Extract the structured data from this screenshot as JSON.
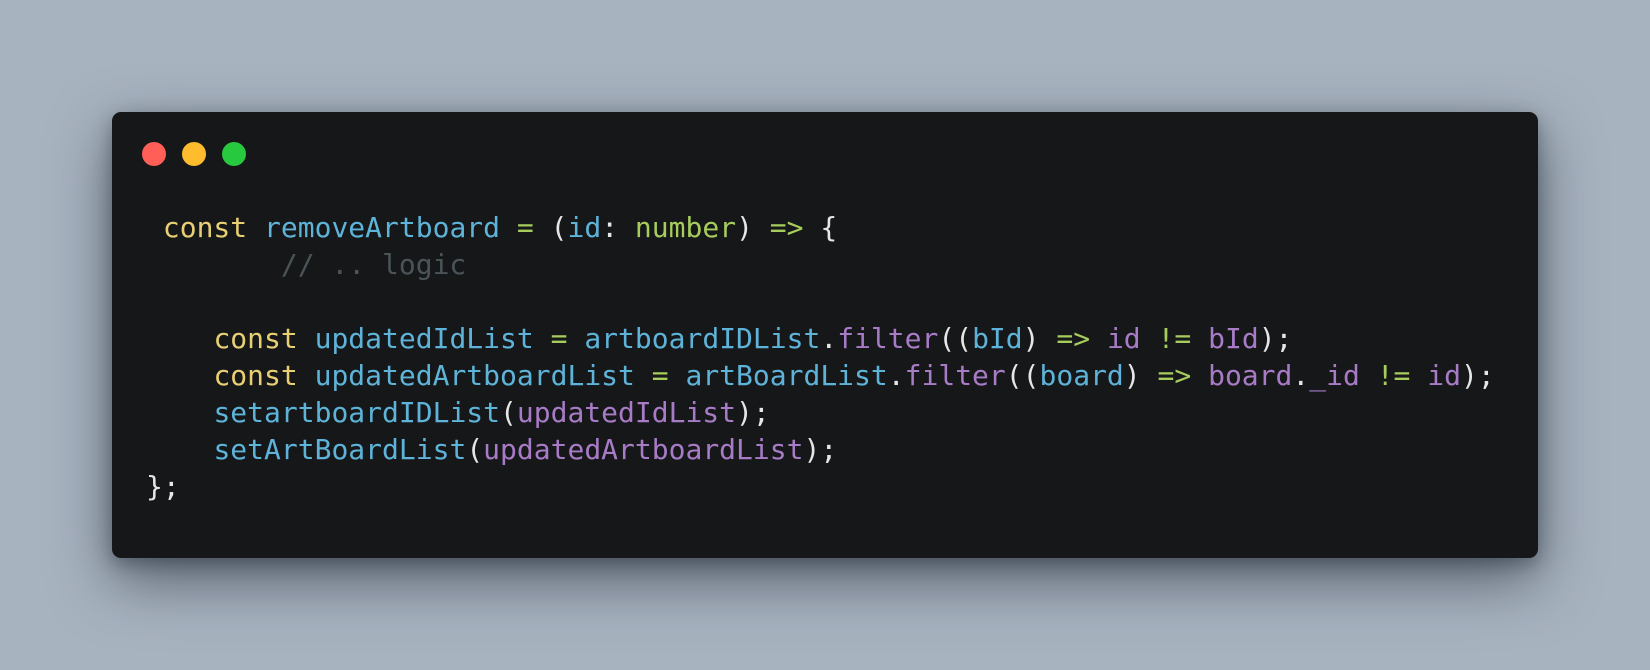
{
  "window": {
    "controls": [
      {
        "name": "close",
        "color": "#ff5f56"
      },
      {
        "name": "minimize",
        "color": "#ffbd2e"
      },
      {
        "name": "maximize",
        "color": "#27c93f"
      }
    ],
    "background": "#161719"
  },
  "code": {
    "lines": [
      [
        {
          "t": " ",
          "c": "ws"
        },
        {
          "t": "const",
          "c": "keyword"
        },
        {
          "t": " ",
          "c": "ws"
        },
        {
          "t": "removeArtboard",
          "c": "ident"
        },
        {
          "t": " ",
          "c": "ws"
        },
        {
          "t": "=",
          "c": "op"
        },
        {
          "t": " ",
          "c": "ws"
        },
        {
          "t": "(",
          "c": "punct"
        },
        {
          "t": "id",
          "c": "ident"
        },
        {
          "t": ": ",
          "c": "punct"
        },
        {
          "t": "number",
          "c": "type"
        },
        {
          "t": ")",
          "c": "punct"
        },
        {
          "t": " ",
          "c": "ws"
        },
        {
          "t": "=>",
          "c": "op"
        },
        {
          "t": " ",
          "c": "ws"
        },
        {
          "t": "{",
          "c": "punct"
        }
      ],
      [
        {
          "t": "        ",
          "c": "ws"
        },
        {
          "t": "// .. logic",
          "c": "comment"
        }
      ],
      [
        {
          "t": " ",
          "c": "ws"
        }
      ],
      [
        {
          "t": "    ",
          "c": "ws"
        },
        {
          "t": "const",
          "c": "keyword"
        },
        {
          "t": " ",
          "c": "ws"
        },
        {
          "t": "updatedIdList",
          "c": "ident"
        },
        {
          "t": " ",
          "c": "ws"
        },
        {
          "t": "=",
          "c": "op"
        },
        {
          "t": " ",
          "c": "ws"
        },
        {
          "t": "artboardIDList",
          "c": "ident"
        },
        {
          "t": ".",
          "c": "punct"
        },
        {
          "t": "filter",
          "c": "method"
        },
        {
          "t": "((",
          "c": "punct"
        },
        {
          "t": "bId",
          "c": "ident"
        },
        {
          "t": ")",
          "c": "punct"
        },
        {
          "t": " ",
          "c": "ws"
        },
        {
          "t": "=>",
          "c": "op"
        },
        {
          "t": " ",
          "c": "ws"
        },
        {
          "t": "id",
          "c": "var"
        },
        {
          "t": " ",
          "c": "ws"
        },
        {
          "t": "!=",
          "c": "op"
        },
        {
          "t": " ",
          "c": "ws"
        },
        {
          "t": "bId",
          "c": "var"
        },
        {
          "t": ");",
          "c": "punct"
        }
      ],
      [
        {
          "t": "    ",
          "c": "ws"
        },
        {
          "t": "const",
          "c": "keyword"
        },
        {
          "t": " ",
          "c": "ws"
        },
        {
          "t": "updatedArtboardList",
          "c": "ident"
        },
        {
          "t": " ",
          "c": "ws"
        },
        {
          "t": "=",
          "c": "op"
        },
        {
          "t": " ",
          "c": "ws"
        },
        {
          "t": "artBoardList",
          "c": "ident"
        },
        {
          "t": ".",
          "c": "punct"
        },
        {
          "t": "filter",
          "c": "method"
        },
        {
          "t": "((",
          "c": "punct"
        },
        {
          "t": "board",
          "c": "ident"
        },
        {
          "t": ")",
          "c": "punct"
        },
        {
          "t": " ",
          "c": "ws"
        },
        {
          "t": "=>",
          "c": "op"
        },
        {
          "t": " ",
          "c": "ws"
        },
        {
          "t": "board",
          "c": "var"
        },
        {
          "t": ".",
          "c": "punct"
        },
        {
          "t": "_id",
          "c": "var"
        },
        {
          "t": " ",
          "c": "ws"
        },
        {
          "t": "!=",
          "c": "op"
        },
        {
          "t": " ",
          "c": "ws"
        },
        {
          "t": "id",
          "c": "var"
        },
        {
          "t": ");",
          "c": "punct"
        }
      ],
      [
        {
          "t": "    ",
          "c": "ws"
        },
        {
          "t": "setartboardIDList",
          "c": "ident"
        },
        {
          "t": "(",
          "c": "punct"
        },
        {
          "t": "updatedIdList",
          "c": "var"
        },
        {
          "t": ");",
          "c": "punct"
        }
      ],
      [
        {
          "t": "    ",
          "c": "ws"
        },
        {
          "t": "setArtBoardList",
          "c": "ident"
        },
        {
          "t": "(",
          "c": "punct"
        },
        {
          "t": "updatedArtboardList",
          "c": "var"
        },
        {
          "t": ");",
          "c": "punct"
        }
      ],
      [
        {
          "t": "};",
          "c": "punct"
        }
      ]
    ]
  }
}
